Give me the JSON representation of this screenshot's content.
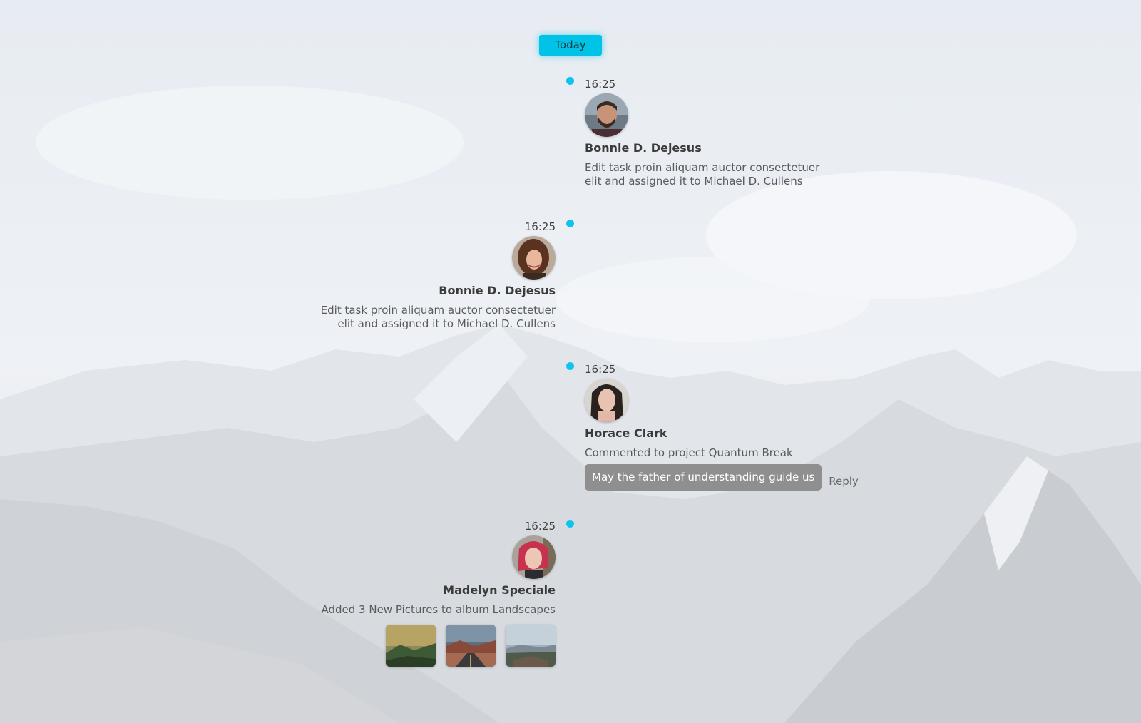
{
  "today_label": "Today",
  "colors": {
    "accent": "#00c3e7",
    "dot": "#0ec4ee",
    "comment_bg": "#8f8f8f"
  },
  "entries": [
    {
      "time": "16:25",
      "name": "Bonnie D. Dejesus",
      "desc_line1": "Edit task proin aliquam auctor consectetuer",
      "desc_line2": "elit and assigned it to Michael D. Cullens"
    },
    {
      "time": "16:25",
      "name": "Bonnie D. Dejesus",
      "desc_line1": "Edit task proin aliquam auctor consectetuer",
      "desc_line2": "elit and assigned it to Michael D. Cullens"
    },
    {
      "time": "16:25",
      "name": "Horace Clark",
      "desc": "Commented to project Quantum Break",
      "comment": "May the father of understanding guide us",
      "reply_label": "Reply"
    },
    {
      "time": "16:25",
      "name": "Madelyn Speciale",
      "desc": "Added 3 New Pictures to album Landscapes"
    }
  ]
}
